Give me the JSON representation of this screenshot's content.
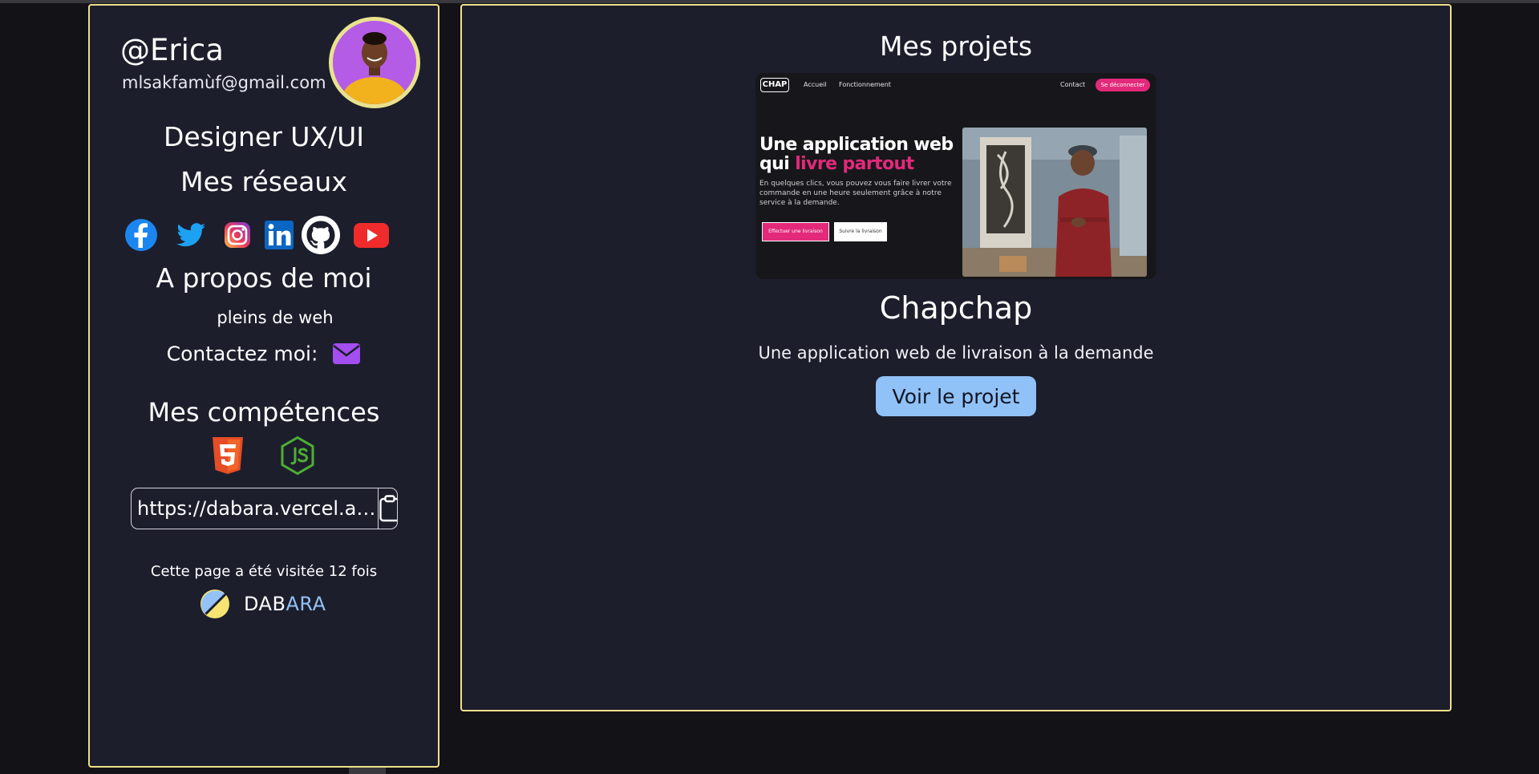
{
  "profile": {
    "username": "@Erica",
    "email": "mlsakfamùf@gmail.com",
    "role": "Designer UX/UI",
    "networks_title": "Mes réseaux",
    "social_icons": [
      "facebook-icon",
      "twitter-icon",
      "instagram-icon",
      "linkedin-icon",
      "github-icon",
      "youtube-icon"
    ],
    "about_title": "A propos de moi",
    "about_text": "pleins de weh",
    "contact_label": "Contactez moi:",
    "skills_title": "Mes compétences",
    "skill_icons": [
      "html5-icon",
      "nodejs-icon"
    ],
    "share_url": "https://dabara.vercel.app/erica",
    "visits_text": "Cette page a été visitée 12 fois",
    "brand_part1": "DAB",
    "brand_part2": "ARA"
  },
  "projects": {
    "title": "Mes projets",
    "items": [
      {
        "name": "Chapchap",
        "description": "Une application web de livraison à la demande",
        "button_label": "Voir le projet",
        "preview": {
          "logo": "CHAP",
          "nav_links": [
            "Accueil",
            "Fonctionnement",
            "Contact"
          ],
          "top_button": "Se déconnecter",
          "headline_line1": "Une application web",
          "headline_line2_plain": "qui",
          "headline_line2_accent": "livre partout",
          "description": "En quelques clics, vous pouvez vous faire livrer votre commande en une heure seulement grâce à notre service à la demande.",
          "cta_primary": "Effectuer une livraison",
          "cta_secondary": "Suivre la livraison"
        }
      }
    ]
  },
  "colors": {
    "background": "#121217",
    "panel": "#1c1e2c",
    "panel_border": "#f1e08a",
    "accent_button": "#90c1f7",
    "preview_pink": "#e2297a",
    "mail_purple": "#a24ef0"
  }
}
